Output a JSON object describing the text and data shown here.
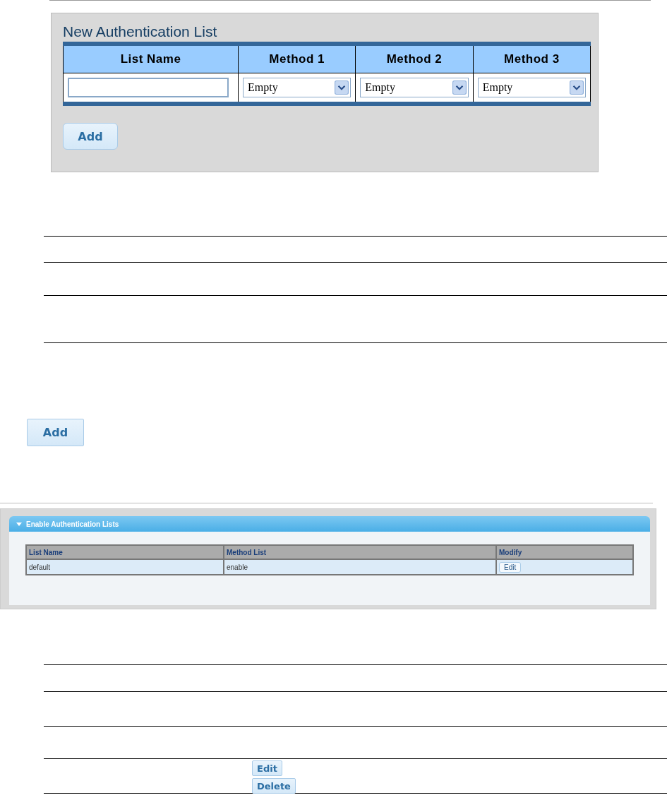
{
  "new_list_panel": {
    "title": "New Authentication List",
    "columns": [
      "List Name",
      "Method 1",
      "Method 2",
      "Method 3"
    ],
    "row": {
      "list_name": {
        "kind": "text"
      },
      "methods": [
        {
          "kind": "select",
          "value": "Empty"
        },
        {
          "kind": "select",
          "value": "Empty"
        },
        {
          "kind": "select",
          "value": "Empty"
        }
      ]
    },
    "button": "Add"
  },
  "add_button": "Add",
  "enable_lists_panel": {
    "title": "Enable Authentication Lists",
    "columns": [
      "List Name",
      "Method List",
      "Modify"
    ],
    "rows": [
      {
        "list_name": "default",
        "method_list": "enable",
        "action": "Edit"
      }
    ]
  },
  "buttons": [
    "Edit",
    "Delete"
  ]
}
